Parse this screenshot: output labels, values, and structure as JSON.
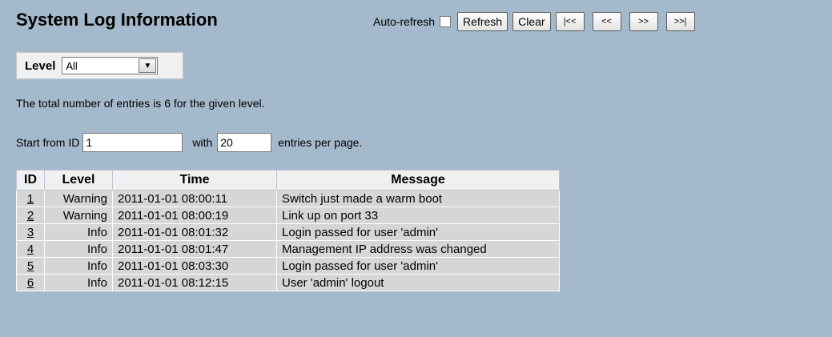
{
  "header": {
    "title": "System Log Information",
    "auto_refresh_label": "Auto-refresh",
    "auto_refresh_checked": false,
    "buttons": {
      "refresh": "Refresh",
      "clear": "Clear",
      "first": "|<<",
      "prev": "<<",
      "next": ">>",
      "last": ">>|"
    }
  },
  "level_filter": {
    "label": "Level",
    "selected": "All"
  },
  "summary": "The total number of entries is 6 for the given level.",
  "pagination": {
    "start_label": "Start from ID",
    "start_value": "1",
    "with_label": "with",
    "per_page_value": "20",
    "entries_label": "entries per page."
  },
  "table": {
    "columns": [
      "ID",
      "Level",
      "Time",
      "Message"
    ],
    "rows": [
      {
        "id": "1",
        "level": "Warning",
        "time": "2011-01-01 08:00:11",
        "message": "Switch just made a warm boot"
      },
      {
        "id": "2",
        "level": "Warning",
        "time": "2011-01-01 08:00:19",
        "message": "Link up on port 33"
      },
      {
        "id": "3",
        "level": "Info",
        "time": "2011-01-01 08:01:32",
        "message": "Login passed for user 'admin'"
      },
      {
        "id": "4",
        "level": "Info",
        "time": "2011-01-01 08:01:47",
        "message": "Management IP address was changed"
      },
      {
        "id": "5",
        "level": "Info",
        "time": "2011-01-01 08:03:30",
        "message": "Login passed for user 'admin'"
      },
      {
        "id": "6",
        "level": "Info",
        "time": "2011-01-01 08:12:15",
        "message": "User 'admin' logout"
      }
    ]
  }
}
